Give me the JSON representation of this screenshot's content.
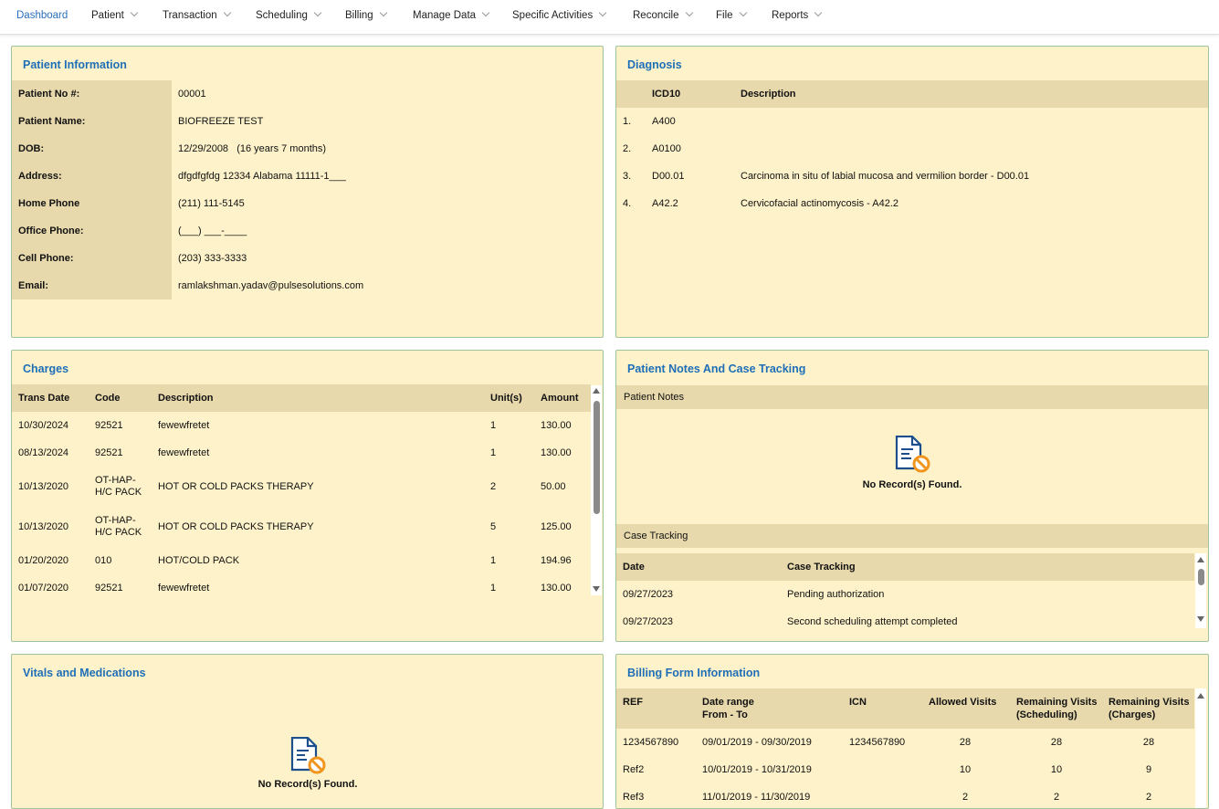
{
  "nav": [
    {
      "label": "Dashboard",
      "active": true
    },
    {
      "label": "Patient"
    },
    {
      "label": "Transaction"
    },
    {
      "label": "Scheduling"
    },
    {
      "label": "Billing"
    },
    {
      "label": "Manage Data"
    },
    {
      "label": "Specific Activities"
    },
    {
      "label": "Reconcile"
    },
    {
      "label": "File"
    },
    {
      "label": "Reports"
    }
  ],
  "patient_info": {
    "title": "Patient Information",
    "fields": [
      {
        "label": "Patient No #:",
        "value": "00001"
      },
      {
        "label": "Patient Name:",
        "value": "BIOFREEZE TEST"
      },
      {
        "label": "DOB:",
        "value": "12/29/2008   (16 years 7 months)"
      },
      {
        "label": "Address:",
        "value": "dfgdfgfdg 12334 Alabama 11111-1___"
      },
      {
        "label": "Home Phone",
        "value": "(211) 111-5145"
      },
      {
        "label": "Office Phone:",
        "value": "(___) ___-____"
      },
      {
        "label": "Cell Phone:",
        "value": "(203) 333-3333"
      },
      {
        "label": "Email:",
        "value": "ramlakshman.yadav@pulsesolutions.com"
      }
    ]
  },
  "diagnosis": {
    "title": "Diagnosis",
    "col_icd": "ICD10",
    "col_desc": "Description",
    "rows": [
      {
        "num": "1.",
        "code": "A400",
        "desc": ""
      },
      {
        "num": "2.",
        "code": "A0100",
        "desc": ""
      },
      {
        "num": "3.",
        "code": "D00.01",
        "desc": "Carcinoma in situ of labial mucosa and vermilion border - D00.01"
      },
      {
        "num": "4.",
        "code": "A42.2",
        "desc": "Cervicofacial actinomycosis - A42.2"
      }
    ]
  },
  "charges": {
    "title": "Charges",
    "headers": {
      "date": "Trans Date",
      "code": "Code",
      "desc": "Description",
      "units": "Unit(s)",
      "amount": "Amount"
    },
    "rows": [
      {
        "date": "10/30/2024",
        "code": "92521",
        "desc": "fewewfretet",
        "units": "1",
        "amount": "130.00"
      },
      {
        "date": "08/13/2024",
        "code": "92521",
        "desc": "fewewfretet",
        "units": "1",
        "amount": "130.00"
      },
      {
        "date": "10/13/2020",
        "code": "OT-HAP-H/C PACK",
        "desc": "HOT OR COLD PACKS THERAPY",
        "units": "2",
        "amount": "50.00"
      },
      {
        "date": "10/13/2020",
        "code": "OT-HAP-H/C PACK",
        "desc": "HOT OR COLD PACKS THERAPY",
        "units": "5",
        "amount": "125.00"
      },
      {
        "date": "01/20/2020",
        "code": "010",
        "desc": "HOT/COLD PACK",
        "units": "1",
        "amount": "194.96"
      },
      {
        "date": "01/07/2020",
        "code": "92521",
        "desc": "fewewfretet",
        "units": "1",
        "amount": "130.00"
      }
    ]
  },
  "notes": {
    "title": "Patient Notes And Case Tracking",
    "notes_label": "Patient Notes",
    "no_records": "No Record(s) Found.",
    "case_label": "Case Tracking",
    "headers": {
      "date": "Date",
      "case": "Case Tracking"
    },
    "rows": [
      {
        "date": "09/27/2023",
        "case": "Pending authorization"
      },
      {
        "date": "09/27/2023",
        "case": "Second scheduling attempt completed"
      }
    ]
  },
  "vitals": {
    "title": "Vitals and Medications",
    "no_records": "No Record(s) Found."
  },
  "billing": {
    "title": "Billing Form Information",
    "headers": {
      "ref": "REF",
      "range1": "Date range",
      "range2": "From - To",
      "icn": "ICN",
      "allowed": "Allowed Visits",
      "rs1": "Remaining Visits",
      "rs2": "(Scheduling)",
      "rc1": "Remaining Visits",
      "rc2": "(Charges)"
    },
    "rows": [
      {
        "ref": "1234567890",
        "range": "09/01/2019 - 09/30/2019",
        "icn": "1234567890",
        "allowed": "28",
        "rs": "28",
        "rc": "28"
      },
      {
        "ref": "Ref2",
        "range": "10/01/2019 - 10/31/2019",
        "icn": "",
        "allowed": "10",
        "rs": "10",
        "rc": "9"
      },
      {
        "ref": "Ref3",
        "range": "11/01/2019 - 11/30/2019",
        "icn": "",
        "allowed": "2",
        "rs": "2",
        "rc": "2"
      }
    ]
  },
  "colors": {
    "accent": "#1f6fb8",
    "panel": "#fdf2c9",
    "header": "#e8d9ac",
    "border": "#9fc49a"
  }
}
